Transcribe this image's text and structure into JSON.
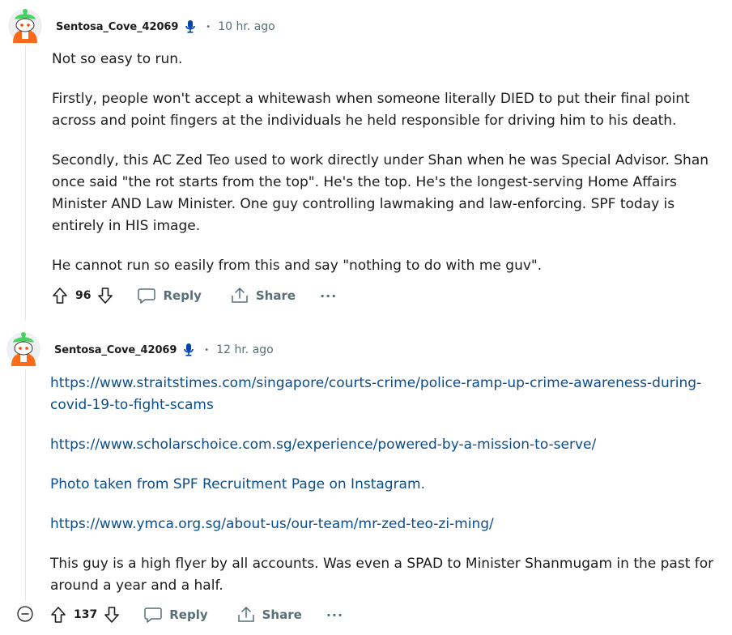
{
  "comments": [
    {
      "username": "Sentosa_Cove_42069",
      "separator": "•",
      "timestamp": "10 hr. ago",
      "paragraphs": [
        "Not so easy to run.",
        "Firstly, people won't accept a whitewash when someone literally DIED to put their final point across and point fingers at the individuals he held responsible for driving him to his death.",
        "Secondly, this AC Zed Teo used to work directly under Shan when he was Special Advisor. Shan once said \"the rot starts from the top\". He's the top. He's the longest-serving Home Affairs Minister AND Law Minister. One guy controlling lawmaking and law-enforcing. SPF today is entirely in HIS image.",
        "He cannot run so easily from this and say \"nothing to do with me guv\"."
      ],
      "score": "96",
      "reply_label": "Reply",
      "share_label": "Share",
      "more_label": "···"
    },
    {
      "username": "Sentosa_Cove_42069",
      "separator": "•",
      "timestamp": "12 hr. ago",
      "links": [
        "https://www.straitstimes.com/singapore/courts-crime/police-ramp-up-crime-awareness-during-covid-19-to-fight-scams",
        "https://www.scholarschoice.com.sg/experience/powered-by-a-mission-to-serve/",
        "Photo taken from SPF Recruitment Page on Instagram.",
        "https://www.ymca.org.sg/about-us/our-team/mr-zed-teo-zi-ming/"
      ],
      "closing": "This guy is a high flyer by all accounts. Was even a SPAD to Minister Shanmugam in the past for around a year and a half.",
      "score": "137",
      "reply_label": "Reply",
      "share_label": "Share",
      "more_label": "···"
    }
  ],
  "colors": {
    "link": "#0a4d8c",
    "meta": "#576f76",
    "text": "#1c1c1c",
    "mic": "#0045ac"
  }
}
